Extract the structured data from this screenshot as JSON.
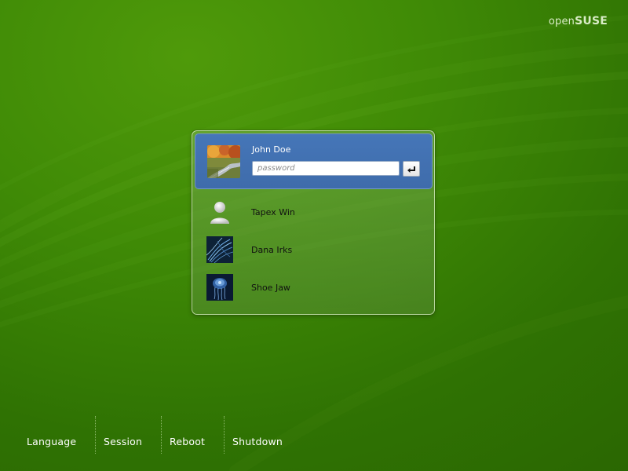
{
  "brand": {
    "part1": "open",
    "part2": "SUSE"
  },
  "users": {
    "selected": {
      "name": "John Doe",
      "password_placeholder": "password",
      "password_value": "",
      "avatar": "autumn-road-photo"
    },
    "others": [
      {
        "name": "Tapex Win",
        "avatar": "generic-user-icon"
      },
      {
        "name": "Dana Irks",
        "avatar": "blue-abstract-photo"
      },
      {
        "name": "Shoe Jaw",
        "avatar": "jellyfish-photo"
      }
    ]
  },
  "bottom_menu": {
    "language": "Language",
    "session": "Session",
    "reboot": "Reboot",
    "shutdown": "Shutdown"
  },
  "icons": {
    "enter": "enter-icon"
  },
  "colors": {
    "background": "#3f8a06",
    "selected_user": "#4576b8",
    "text_dark": "#111111",
    "text_light": "#ffffff"
  }
}
